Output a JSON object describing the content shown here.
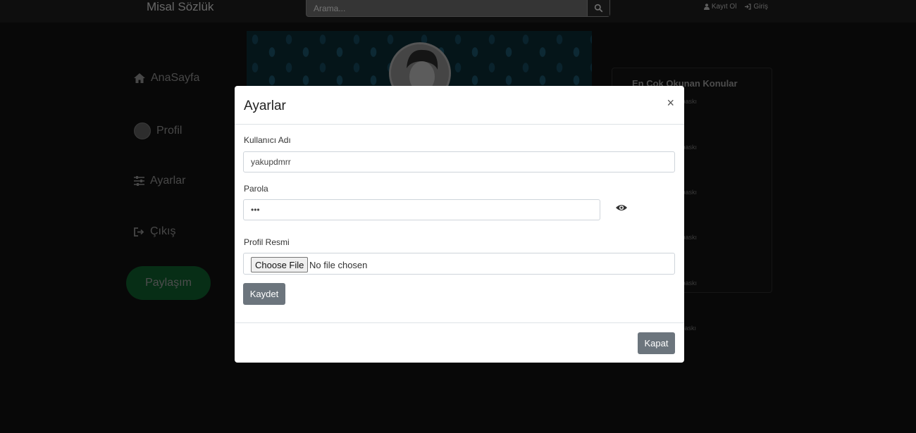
{
  "navbar": {
    "brand": "Misal Sözlük",
    "search_placeholder": "Arama...",
    "register_label": "Kayıt Ol",
    "login_label": "Giriş"
  },
  "sidebar": {
    "items": [
      {
        "label": "AnaSayfa",
        "icon": "home-icon"
      },
      {
        "label": "Profil",
        "icon": "avatar-icon"
      },
      {
        "label": "Ayarlar",
        "icon": "sliders-icon"
      },
      {
        "label": "Çıkış",
        "icon": "sign-out-icon"
      }
    ],
    "share_label": "Paylaşım"
  },
  "right_panel": {
    "title": "En Çok Okunan Konular",
    "item_fragments": [
      "i ve baskı",
      "i ve baskı",
      "i ve baskı",
      "i ve baskı",
      "i ve baskı",
      "i ve baskı"
    ]
  },
  "modal": {
    "title": "Ayarlar",
    "close_symbol": "×",
    "username_label": "Kullanıcı Adı",
    "username_value": "yakupdmrr",
    "password_label": "Parola",
    "password_value": "•••",
    "profile_image_label": "Profil Resmi",
    "choose_file_label": "Choose File",
    "file_status": "No file chosen",
    "save_label": "Kaydet",
    "close_label": "Kapat"
  }
}
